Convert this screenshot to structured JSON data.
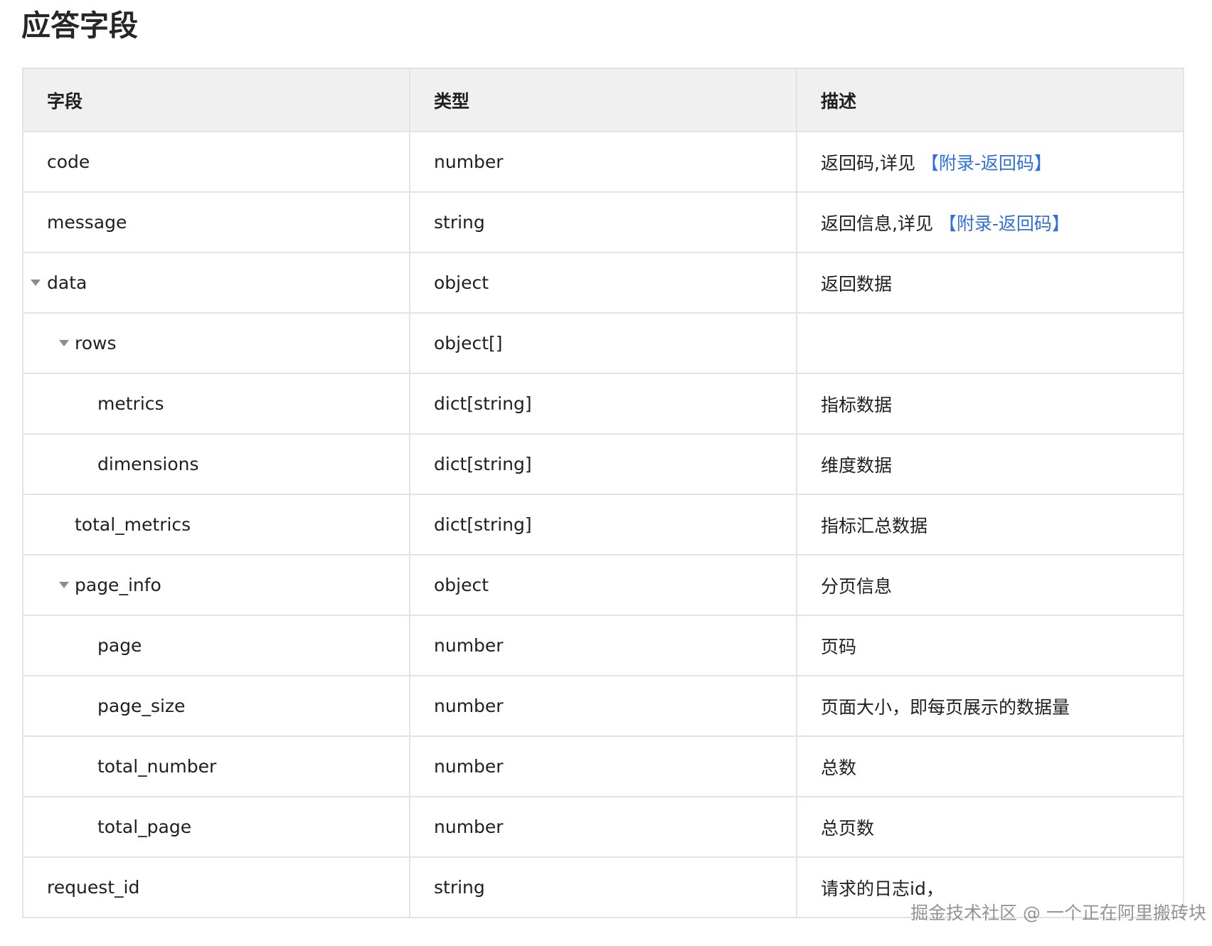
{
  "page": {
    "title": "应答字段"
  },
  "table": {
    "headers": {
      "field": "字段",
      "type": "类型",
      "desc": "描述"
    },
    "rows": [
      {
        "field": "code",
        "type": "number",
        "desc": "返回码,详见 ",
        "link": "【附录-返回码】",
        "collapsible": false
      },
      {
        "field": "message",
        "type": "string",
        "desc": "返回信息,详见 ",
        "link": "【附录-返回码】",
        "collapsible": false
      },
      {
        "field": "data",
        "type": "object",
        "desc": "返回数据",
        "collapsible": true,
        "expanded": true
      },
      {
        "field": "rows",
        "type": "object[]",
        "desc": "",
        "collapsible": true,
        "expanded": true
      },
      {
        "field": "metrics",
        "type": "dict[string]",
        "desc": "指标数据",
        "collapsible": false
      },
      {
        "field": "dimensions",
        "type": "dict[string]",
        "desc": "维度数据",
        "collapsible": false
      },
      {
        "field": "total_metrics",
        "type": "dict[string]",
        "desc": "指标汇总数据",
        "collapsible": false
      },
      {
        "field": "page_info",
        "type": "object",
        "desc": "分页信息",
        "collapsible": true,
        "expanded": true
      },
      {
        "field": "page",
        "type": "number",
        "desc": "页码",
        "collapsible": false
      },
      {
        "field": "page_size",
        "type": "number",
        "desc": "页面大小，即每页展示的数据量",
        "collapsible": false
      },
      {
        "field": "total_number",
        "type": "number",
        "desc": "总数",
        "collapsible": false
      },
      {
        "field": "total_page",
        "type": "number",
        "desc": "总页数",
        "collapsible": false
      },
      {
        "field": "request_id",
        "type": "string",
        "desc": "请求的日志id，",
        "collapsible": false
      }
    ]
  },
  "watermark": "掘金技术社区 @ 一个正在阿里搬砖块",
  "colors": {
    "link": "#2f6fe0",
    "header_bg": "#f0f0f0",
    "border": "#e3e3e3",
    "caret": "#8c8c8c"
  }
}
